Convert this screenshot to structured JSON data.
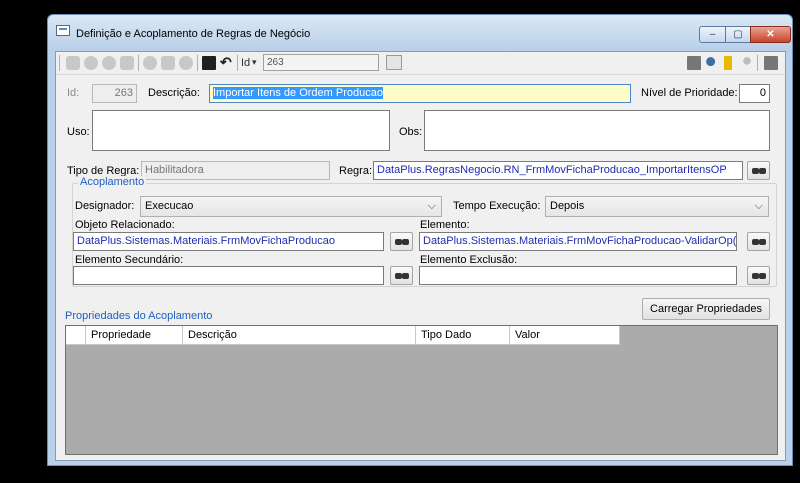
{
  "window": {
    "title": "Definição e Acoplamento de Regras de Negócio",
    "min": "‒",
    "max": "▢",
    "close": "✕"
  },
  "toolbar": {
    "id_label": "Id",
    "id_value": "263",
    "icons": [
      "first-icon",
      "prev-icon",
      "next-icon",
      "last-icon",
      "add-icon",
      "edit-icon",
      "delete-icon",
      "save-icon",
      "undo-icon",
      "search-icon",
      "copy-icon",
      "key-icon",
      "report-icon",
      "user-icon",
      "exit-icon"
    ]
  },
  "form": {
    "id_label": "Id:",
    "id_value": "263",
    "descricao_label": "Descrição:",
    "descricao_value": "Importar Itens de Ordem Producao",
    "prioridade_label": "Nível de Prioridade:",
    "prioridade_value": "0",
    "uso_label": "Uso:",
    "obs_label": "Obs:",
    "tipo_regra_label": "Tipo de Regra:",
    "tipo_regra_value": "Habilitadora",
    "regra_label": "Regra:",
    "regra_value": "DataPlus.RegrasNegocio.RN_FrmMovFichaProducao_ImportarItensOP"
  },
  "acoplamento": {
    "title": "Acoplamento",
    "designador_label": "Designador:",
    "designador_value": "Execucao",
    "tempo_label": "Tempo Execução:",
    "tempo_value": "Depois",
    "objeto_label": "Objeto Relacionado:",
    "objeto_value": "DataPlus.Sistemas.Materiais.FrmMovFichaProducao",
    "elemento_label": "Elemento:",
    "elemento_value": "DataPlus.Sistemas.Materiais.FrmMovFichaProducao-ValidarOp()",
    "secundario_label": "Elemento Secundário:",
    "secundario_value": "",
    "exclusao_label": "Elemento Exclusão:",
    "exclusao_value": ""
  },
  "propriedades": {
    "title": "Propriedades do Acoplamento",
    "button": "Carregar Propriedades",
    "columns": [
      "Propriedade",
      "Descrição",
      "Tipo Dado",
      "Valor"
    ]
  }
}
